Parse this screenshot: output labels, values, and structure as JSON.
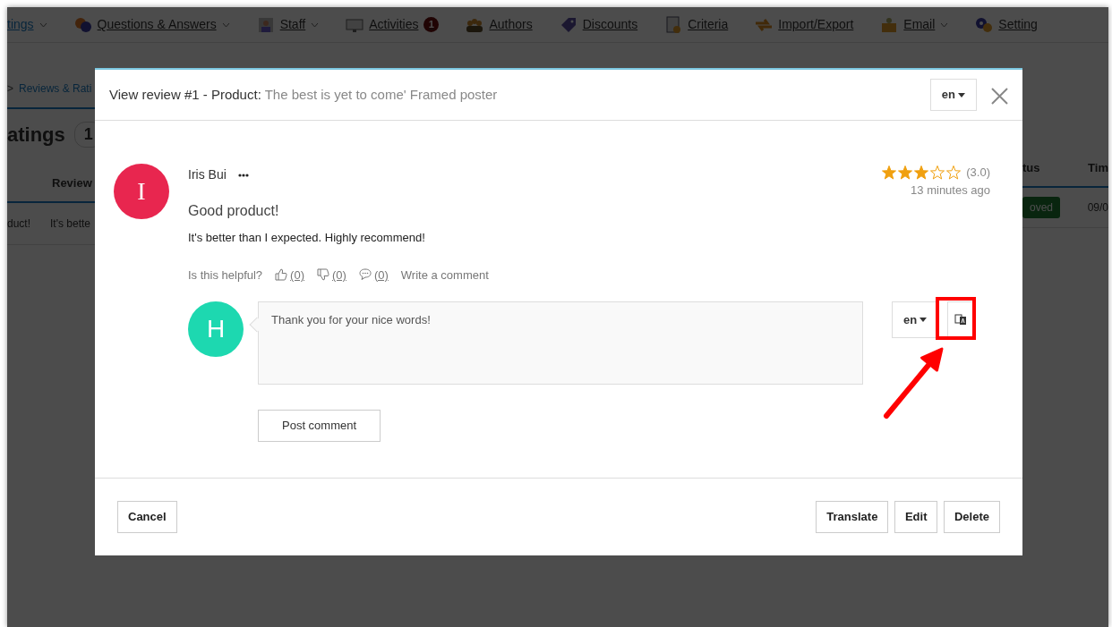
{
  "nav": {
    "items": [
      {
        "label": "tings",
        "dropdown": true,
        "selected": true
      },
      {
        "label": "Questions & Answers",
        "dropdown": true,
        "selected": false
      },
      {
        "label": "Staff",
        "dropdown": true,
        "selected": false
      },
      {
        "label": "Activities",
        "dropdown": false,
        "badge": "1",
        "selected": false
      },
      {
        "label": "Authors",
        "dropdown": false,
        "selected": false
      },
      {
        "label": "Discounts",
        "dropdown": false,
        "selected": false
      },
      {
        "label": "Criteria",
        "dropdown": false,
        "selected": false
      },
      {
        "label": "Import/Export",
        "dropdown": false,
        "selected": false
      },
      {
        "label": "Email",
        "dropdown": true,
        "selected": false
      },
      {
        "label": "Setting",
        "dropdown": false,
        "selected": false
      }
    ]
  },
  "breadcrumb": {
    "separator": ">",
    "current": "Reviews & Rati"
  },
  "page_title": {
    "text": "atings",
    "count": "1"
  },
  "left_table": {
    "header": "Review",
    "cells": [
      "duct!",
      "It's bette"
    ]
  },
  "right_table": {
    "columns": [
      "tus",
      "Tim"
    ],
    "status": "oved",
    "date": "09/0"
  },
  "modal": {
    "title_prefix": "View review #1 - Product:",
    "product": "The best is yet to come' Framed poster",
    "language": "en",
    "review": {
      "avatar_letter": "I",
      "author": "Iris Bui",
      "stars": 3,
      "rating": "(3.0)",
      "time": "13 minutes ago",
      "title": "Good product!",
      "body": "It's better than I expected. Highly recommend!",
      "helpful_label": "Is this helpful?",
      "reactions": [
        {
          "kind": "like",
          "count": "(0)"
        },
        {
          "kind": "dislike",
          "count": "(0)"
        },
        {
          "kind": "comment",
          "count": "(0)"
        }
      ],
      "write_comment": "Write a comment"
    },
    "reply": {
      "avatar_letter": "H",
      "value": "Thank you for your nice words!",
      "language": "en",
      "post_button": "Post comment",
      "highlighted": true
    },
    "footer": {
      "cancel": "Cancel",
      "actions": [
        "Translate",
        "Edit",
        "Delete"
      ]
    }
  }
}
